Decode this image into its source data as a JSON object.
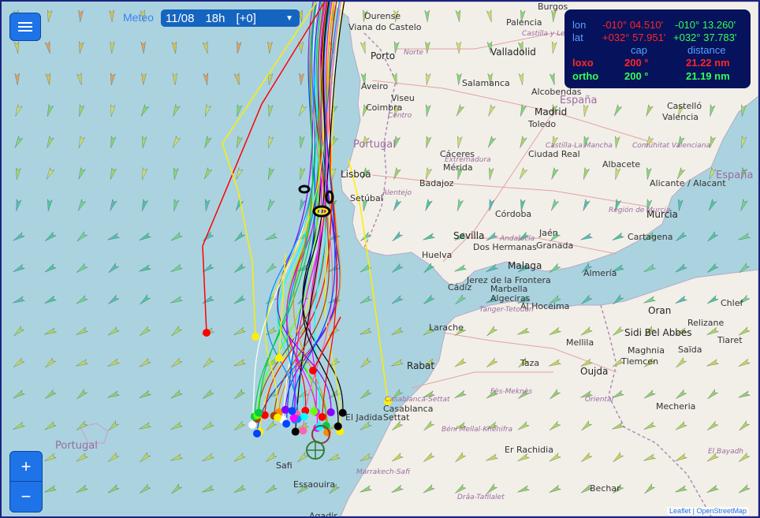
{
  "toolbar": {
    "meteo_label": "Meteo",
    "date": "11/08",
    "hour": "18h",
    "offset": "[+0]"
  },
  "info_panel": {
    "lon_label": "lon",
    "lon_red": "-010° 04.510'",
    "lon_green": "-010° 13.260'",
    "lat_label": "lat",
    "lat_red": "+032° 57.951'",
    "lat_green": "+032° 37.783'",
    "cap_header": "cap",
    "distance_header": "distance",
    "loxo_label": "loxo",
    "loxo_cap": "200 °",
    "loxo_distance": "21.22 nm",
    "ortho_label": "ortho",
    "ortho_cap": "200 °",
    "ortho_distance": "21.19 nm"
  },
  "zoom": {
    "in": "+",
    "out": "−"
  },
  "attribution": {
    "leaflet": "Leaflet",
    "separator": "|",
    "osm": "OpenStreetMap"
  },
  "colors": {
    "sea": "#aad3df",
    "land": "#f2efe9",
    "panel": "#06125c",
    "buttons": "#1e73e8",
    "loxo": "#ff2626",
    "ortho": "#33ff55"
  },
  "map_labels": {
    "cities": [
      "Burgos",
      "Ourense",
      "Viana do Castelo",
      "Palencia",
      "Valladolid",
      "Porto",
      "Aveiro",
      "Viseu",
      "Salamanca",
      "Coimbra",
      "Madrid",
      "Alcobendas",
      "Toledo",
      "Castelló",
      "Valencia",
      "Lisboa",
      "Setúbal",
      "Cáceres",
      "Mérida",
      "Ciudad Real",
      "Albacete",
      "Badajoz",
      "Alicante / Alacant",
      "Murcia",
      "Córdoba",
      "Jaén",
      "Cartagena",
      "Sevilla",
      "Huelva",
      "Dos Hermanas",
      "Granada",
      "Jerez de la Frontera",
      "Malaga",
      "Almería",
      "Cádiz",
      "Marbella",
      "Algeciras",
      "Al Hoceima",
      "Chlef",
      "Oran",
      "Relizane",
      "Larache",
      "Tiaret",
      "Sidi Bel Abbes",
      "Saïda",
      "Rabat",
      "Mellila",
      "Maghnia",
      "Tlemcen",
      "Taza",
      "Oujda",
      "Casablanca",
      "Settat",
      "Mecheria",
      "El Jadida",
      "Er Rachidia",
      "Safi",
      "El Bayadh",
      "Essaouira",
      "Bechar",
      "Agadir"
    ],
    "countries": [
      "España",
      "Portugal",
      "España",
      "Portugal"
    ],
    "regions": [
      "Castilla y León",
      "Norte",
      "Centro",
      "Extremadura",
      "Alentejo",
      "Castilla-La Mancha",
      "Comunitat Valenciana",
      "Andalucía",
      "Región de Murcia",
      "Tanger-Tetouan",
      "Fès-Meknès",
      "Oriental",
      "Béni Mellal-Khénifra",
      "Marrakech-Safi",
      "Drâa-Tafilalet",
      "Casablanca-Settat"
    ]
  }
}
